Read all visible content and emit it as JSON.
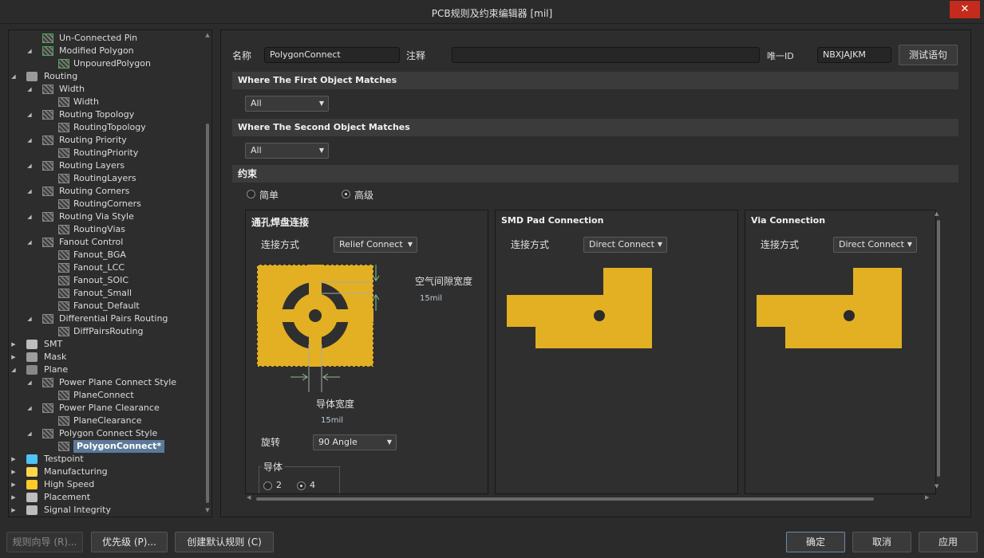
{
  "window": {
    "title": "PCB规则及约束编辑器 [mil]",
    "close_glyph": "✕"
  },
  "tree": [
    {
      "label": "Un-Connected Pin",
      "depth": 2,
      "toggle": "",
      "icon": "rule-green-icon"
    },
    {
      "label": "Modified Polygon",
      "depth": 2,
      "toggle": "◢",
      "icon": "rule-green-icon"
    },
    {
      "label": "UnpouredPolygon",
      "depth": 3,
      "toggle": "",
      "icon": "rule-green-icon"
    },
    {
      "label": "Routing",
      "depth": 1,
      "toggle": "◢",
      "icon": "routing-icon"
    },
    {
      "label": "Width",
      "depth": 2,
      "toggle": "◢",
      "icon": "routing-rule-icon"
    },
    {
      "label": "Width",
      "depth": 3,
      "toggle": "",
      "icon": "routing-rule-icon"
    },
    {
      "label": "Routing Topology",
      "depth": 2,
      "toggle": "◢",
      "icon": "routing-rule-icon"
    },
    {
      "label": "RoutingTopology",
      "depth": 3,
      "toggle": "",
      "icon": "routing-rule-icon"
    },
    {
      "label": "Routing Priority",
      "depth": 2,
      "toggle": "◢",
      "icon": "routing-rule-icon"
    },
    {
      "label": "RoutingPriority",
      "depth": 3,
      "toggle": "",
      "icon": "routing-rule-icon"
    },
    {
      "label": "Routing Layers",
      "depth": 2,
      "toggle": "◢",
      "icon": "routing-rule-icon"
    },
    {
      "label": "RoutingLayers",
      "depth": 3,
      "toggle": "",
      "icon": "routing-rule-icon"
    },
    {
      "label": "Routing Corners",
      "depth": 2,
      "toggle": "◢",
      "icon": "routing-rule-icon"
    },
    {
      "label": "RoutingCorners",
      "depth": 3,
      "toggle": "",
      "icon": "routing-rule-icon"
    },
    {
      "label": "Routing Via Style",
      "depth": 2,
      "toggle": "◢",
      "icon": "routing-rule-icon"
    },
    {
      "label": "RoutingVias",
      "depth": 3,
      "toggle": "",
      "icon": "routing-rule-icon"
    },
    {
      "label": "Fanout Control",
      "depth": 2,
      "toggle": "◢",
      "icon": "routing-rule-icon"
    },
    {
      "label": "Fanout_BGA",
      "depth": 3,
      "toggle": "",
      "icon": "routing-rule-icon"
    },
    {
      "label": "Fanout_LCC",
      "depth": 3,
      "toggle": "",
      "icon": "routing-rule-icon"
    },
    {
      "label": "Fanout_SOIC",
      "depth": 3,
      "toggle": "",
      "icon": "routing-rule-icon"
    },
    {
      "label": "Fanout_Small",
      "depth": 3,
      "toggle": "",
      "icon": "routing-rule-icon"
    },
    {
      "label": "Fanout_Default",
      "depth": 3,
      "toggle": "",
      "icon": "routing-rule-icon"
    },
    {
      "label": "Differential Pairs Routing",
      "depth": 2,
      "toggle": "◢",
      "icon": "routing-rule-icon"
    },
    {
      "label": "DiffPairsRouting",
      "depth": 3,
      "toggle": "",
      "icon": "routing-rule-icon"
    },
    {
      "label": "SMT",
      "depth": 1,
      "toggle": "▶",
      "icon": "smt-icon"
    },
    {
      "label": "Mask",
      "depth": 1,
      "toggle": "▶",
      "icon": "mask-icon"
    },
    {
      "label": "Plane",
      "depth": 1,
      "toggle": "◢",
      "icon": "plane-icon"
    },
    {
      "label": "Power Plane Connect Style",
      "depth": 2,
      "toggle": "◢",
      "icon": "plane-rule-icon"
    },
    {
      "label": "PlaneConnect",
      "depth": 3,
      "toggle": "",
      "icon": "plane-rule-icon"
    },
    {
      "label": "Power Plane Clearance",
      "depth": 2,
      "toggle": "◢",
      "icon": "plane-rule-icon"
    },
    {
      "label": "PlaneClearance",
      "depth": 3,
      "toggle": "",
      "icon": "plane-rule-icon"
    },
    {
      "label": "Polygon Connect Style",
      "depth": 2,
      "toggle": "◢",
      "icon": "plane-rule-icon"
    },
    {
      "label": "PolygonConnect*",
      "depth": 3,
      "toggle": "",
      "icon": "plane-rule-icon",
      "selected": true
    },
    {
      "label": "Testpoint",
      "depth": 1,
      "toggle": "▶",
      "icon": "testpoint-icon"
    },
    {
      "label": "Manufacturing",
      "depth": 1,
      "toggle": "▶",
      "icon": "manufacturing-icon"
    },
    {
      "label": "High Speed",
      "depth": 1,
      "toggle": "▶",
      "icon": "high-speed-icon"
    },
    {
      "label": "Placement",
      "depth": 1,
      "toggle": "▶",
      "icon": "placement-icon"
    },
    {
      "label": "Signal Integrity",
      "depth": 1,
      "toggle": "▶",
      "icon": "signal-integrity-icon"
    }
  ],
  "rule": {
    "name_label": "名称",
    "name_value": "PolygonConnect",
    "comment_label": "注释",
    "comment_value": "",
    "uid_label": "唯一ID",
    "uid_value": "NBXJAJKM",
    "test_button": "测试语句"
  },
  "first_match": {
    "title": "Where The First Object Matches",
    "value": "All"
  },
  "second_match": {
    "title": "Where The Second Object Matches",
    "value": "All"
  },
  "constraints": {
    "title": "约束",
    "mode_simple": "简单",
    "mode_advanced": "高级",
    "mode_selected": "advanced"
  },
  "through_hole": {
    "title": "通孔焊盘连接",
    "connect_label": "连接方式",
    "connect_value": "Relief Connect",
    "air_gap_label": "空气间隙宽度",
    "air_gap_value": "15mil",
    "conductor_width_label": "导体宽度",
    "conductor_width_value": "15mil",
    "rotation_label": "旋转",
    "rotation_value": "90 Angle",
    "conductors_label": "导体",
    "conductors_opt1": "2",
    "conductors_opt2": "4",
    "conductors_selected": "4"
  },
  "smd": {
    "title": "SMD Pad Connection",
    "connect_label": "连接方式",
    "connect_value": "Direct Connect"
  },
  "via": {
    "title": "Via Connection",
    "connect_label": "连接方式",
    "connect_value": "Direct Connect"
  },
  "colors": {
    "copper": "#e2b022",
    "hole": "#2b2b2b",
    "background": "#2d2d2d",
    "selection": "#5b7a99"
  },
  "bottom": {
    "wizard": "规则向导 (R)...",
    "priority": "优先级 (P)...",
    "create_default": "创建默认规则 (C)",
    "ok": "确定",
    "cancel": "取消",
    "apply": "应用"
  }
}
